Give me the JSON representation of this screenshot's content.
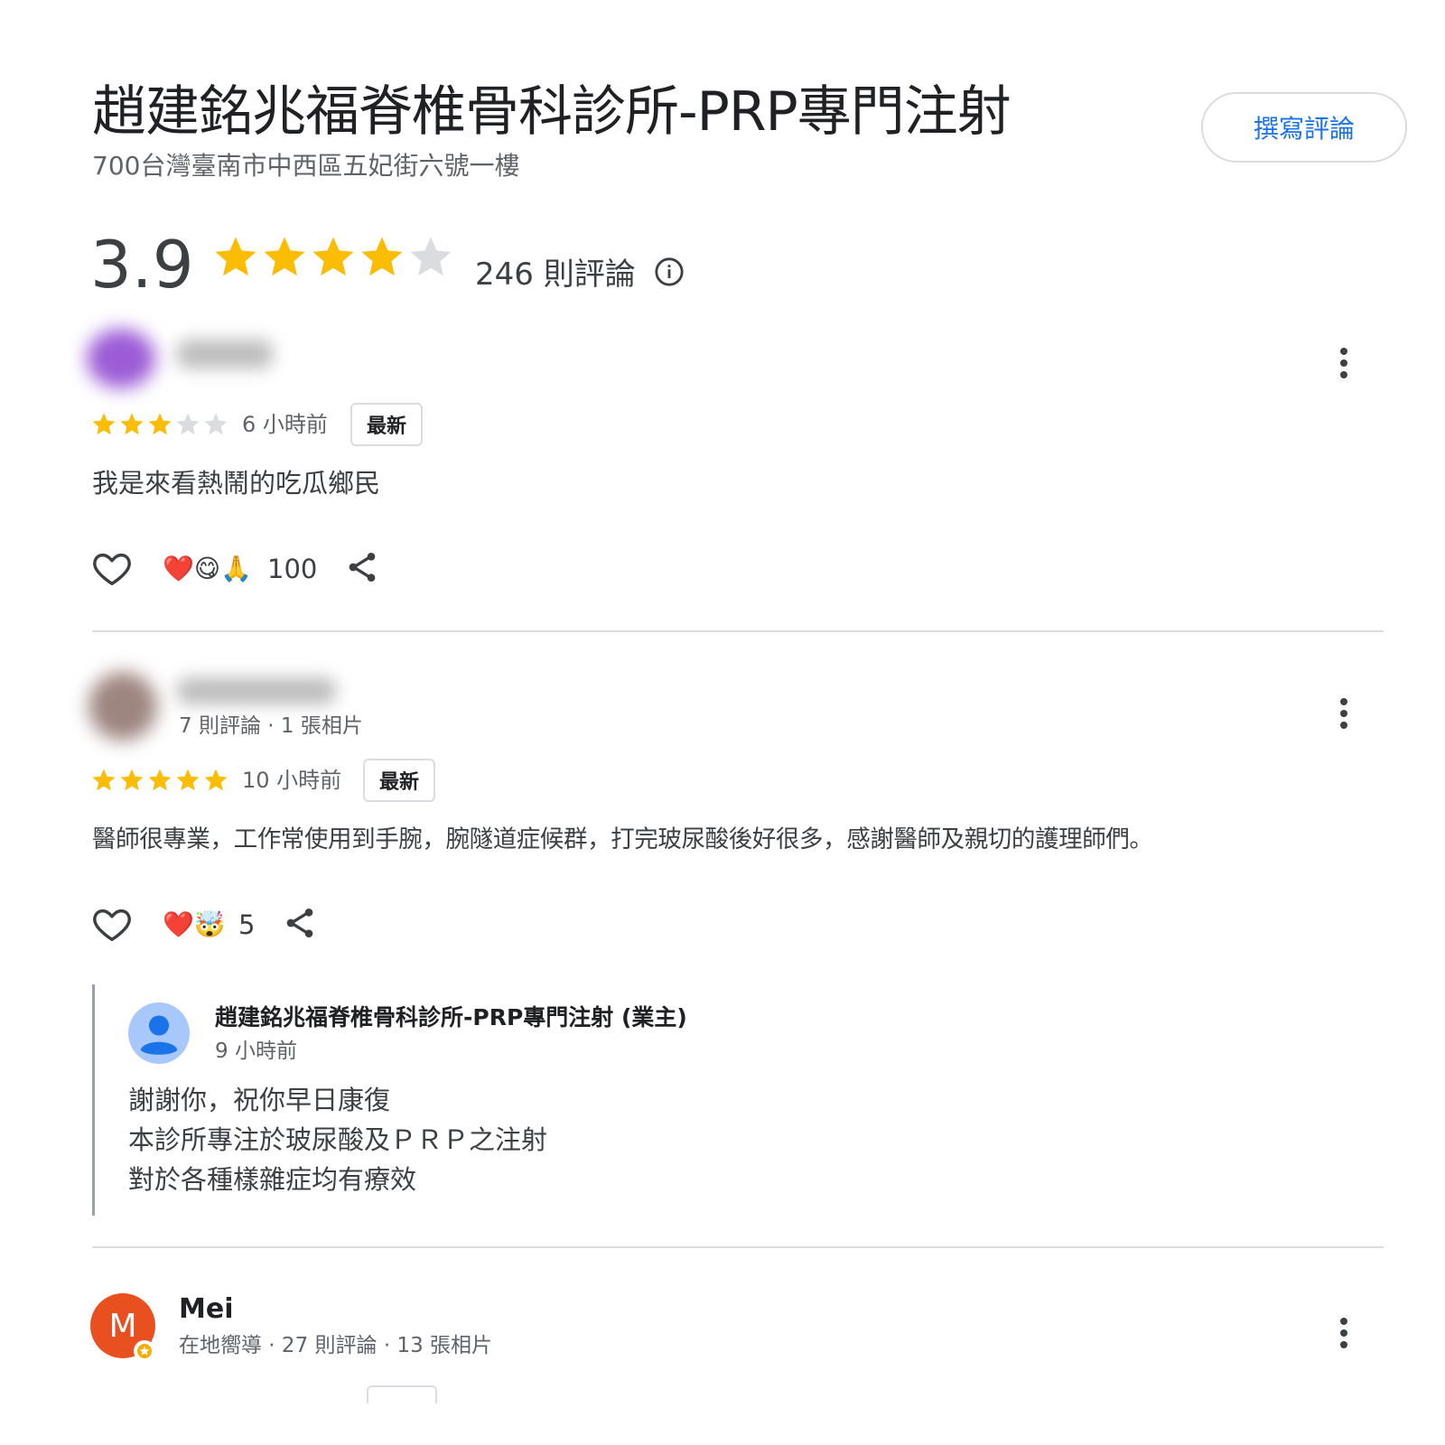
{
  "header": {
    "title": "趙建銘兆福脊椎骨科診所-PRP專門注射",
    "address": "700台灣臺南市中西區五妃街六號一樓",
    "write_review_label": "撰寫評論"
  },
  "summary": {
    "rating": "3.9",
    "stars": 3.9,
    "review_count": "246 則評論",
    "star_color": "#fbbc04",
    "star_empty_color": "#dadce0"
  },
  "reviews": [
    {
      "stars": 3,
      "time": "6 小時前",
      "badge": "最新",
      "text": "我是來看熱鬧的吃瓜鄉民",
      "reactions_emoji": "❤️😋🙏",
      "reactions_count": "100"
    },
    {
      "meta": "7 則評論 · 1 張相片",
      "stars": 5,
      "time": "10 小時前",
      "badge": "最新",
      "text": "醫師很專業，工作常使用到手腕，腕隧道症候群，打完玻尿酸後好很多，感謝醫師及親切的護理師們。",
      "reactions_emoji": "❤️🤯",
      "reactions_count": "5",
      "reply": {
        "owner": "趙建銘兆福脊椎骨科診所-PRP專門注射 (業主)",
        "time": "9 小時前",
        "lines": [
          "謝謝你，祝你早日康復",
          "本診所專注於玻尿酸及ＰＲＰ之注射",
          "對於各種樣雜症均有療效"
        ]
      }
    },
    {
      "avatar_letter": "M",
      "name": "Mei",
      "meta": "在地嚮導 · 27 則評論 · 13 張相片"
    }
  ],
  "colors": {
    "accent": "#1a73e8",
    "mei_avatar": "#e8501f",
    "owner_avatar": "#a8c7fa"
  }
}
